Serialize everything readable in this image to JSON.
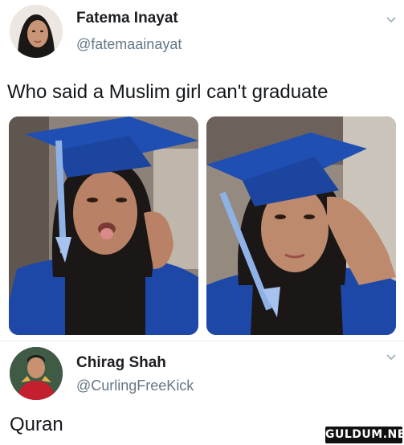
{
  "tweet": {
    "author_name": "Fatema Inayat",
    "author_handle": "@fatemaainayat",
    "text": "Who said a Muslim girl can't graduate",
    "media": [
      {
        "description_icon": "graduate-photo-tongue-out"
      },
      {
        "description_icon": "graduate-photo-hand-on-head"
      }
    ]
  },
  "reply": {
    "author_name": "Chirag Shah",
    "author_handle": "@CurlingFreeKick",
    "text": "Quran"
  },
  "watermark": {
    "text": "GULDUM.NET"
  },
  "colors": {
    "handle_gray": "#657786",
    "text_black": "#14171a",
    "cap_blue": "#1f4fb3",
    "tassel_blue": "#8fb2e6"
  }
}
